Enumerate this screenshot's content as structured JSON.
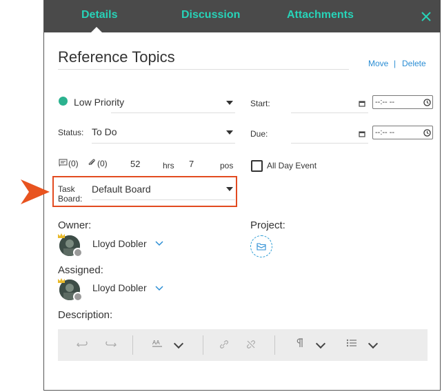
{
  "tabs": [
    {
      "label": "Details",
      "active": true
    },
    {
      "label": "Discussion",
      "active": false
    },
    {
      "label": "Attachments",
      "active": false
    }
  ],
  "task": {
    "title": "Reference Topics",
    "move_label": "Move",
    "separator": "|",
    "delete_label": "Delete",
    "priority": "Low Priority",
    "status_label": "Status:",
    "status_value": "To Do",
    "start_label": "Start:",
    "due_label": "Due:",
    "time_placeholder": "--:-- --",
    "notes_count": "(0)",
    "attach_count": "(0)",
    "hours_value": "52",
    "hours_unit": "hrs",
    "pos_value": "7",
    "pos_unit": "pos",
    "all_day_label": "All Day Event",
    "task_board_label_1": "Task",
    "task_board_label_2": "Board:",
    "task_board_value": "Default Board",
    "owner_label": "Owner:",
    "owner_name": "Lloyd Dobler",
    "project_label": "Project:",
    "assigned_label": "Assigned:",
    "assigned_name": "Lloyd Dobler",
    "description_label": "Description:"
  },
  "colors": {
    "accent": "#27d3b8",
    "header_bg": "#4a4a4a",
    "link": "#2a8dd4",
    "priority_dot": "#2bb28f",
    "highlight": "#e24a1f"
  },
  "icons": {
    "close": "close-icon",
    "calendar": "calendar-icon",
    "clock": "clock-icon",
    "notes": "notes-icon",
    "paperclip": "paperclip-icon",
    "folder": "folder-icon"
  }
}
